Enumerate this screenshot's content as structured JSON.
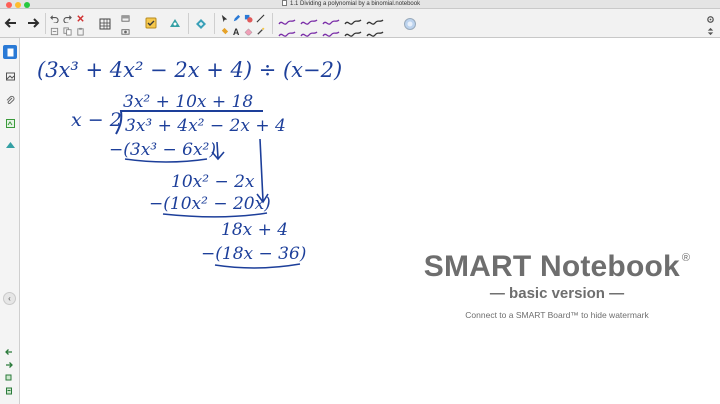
{
  "window": {
    "title": "1.1 Dividing a polynomial by a binomial.notebook"
  },
  "toolbar": {
    "buttons": [
      "back-icon",
      "forward-icon",
      "undo-icon",
      "redo-icon",
      "delete-icon",
      "table-icon",
      "paste-icon",
      "screen-icon",
      "measurement-icon",
      "activity-icon",
      "add-page-icon",
      "select-icon",
      "pen-icon",
      "shapes-icon",
      "fill-icon",
      "text-icon",
      "eraser-icon"
    ]
  },
  "sidebar": {
    "items": [
      "page-sorter-icon",
      "gallery-icon",
      "attachments-icon",
      "properties-icon",
      "addons-icon"
    ],
    "collapse_label": "‹"
  },
  "handwriting": {
    "problem": "(3x³ + 4x² − 2x + 4) ÷ (x−2)",
    "divisor": "x − 2",
    "quotient": "3x² + 10x + 18",
    "dividend": "3x³ + 4x² − 2x + 4",
    "step1_subtract": "−(3x³ − 6x²)",
    "step1_remainder": "10x² − 2x",
    "step2_subtract": "−(10x² − 20x)",
    "step2_remainder": "18x + 4",
    "step3_subtract": "−(18x − 36)"
  },
  "watermark": {
    "title": "SMART Notebook",
    "registered_mark": "®",
    "subtitle": "— basic version —",
    "note": "Connect to a SMART Board™ to hide watermark"
  },
  "colors": {
    "ink": "#1d3f9a",
    "accent": "#2a7ad6",
    "watermark": "#6e6e6e"
  }
}
